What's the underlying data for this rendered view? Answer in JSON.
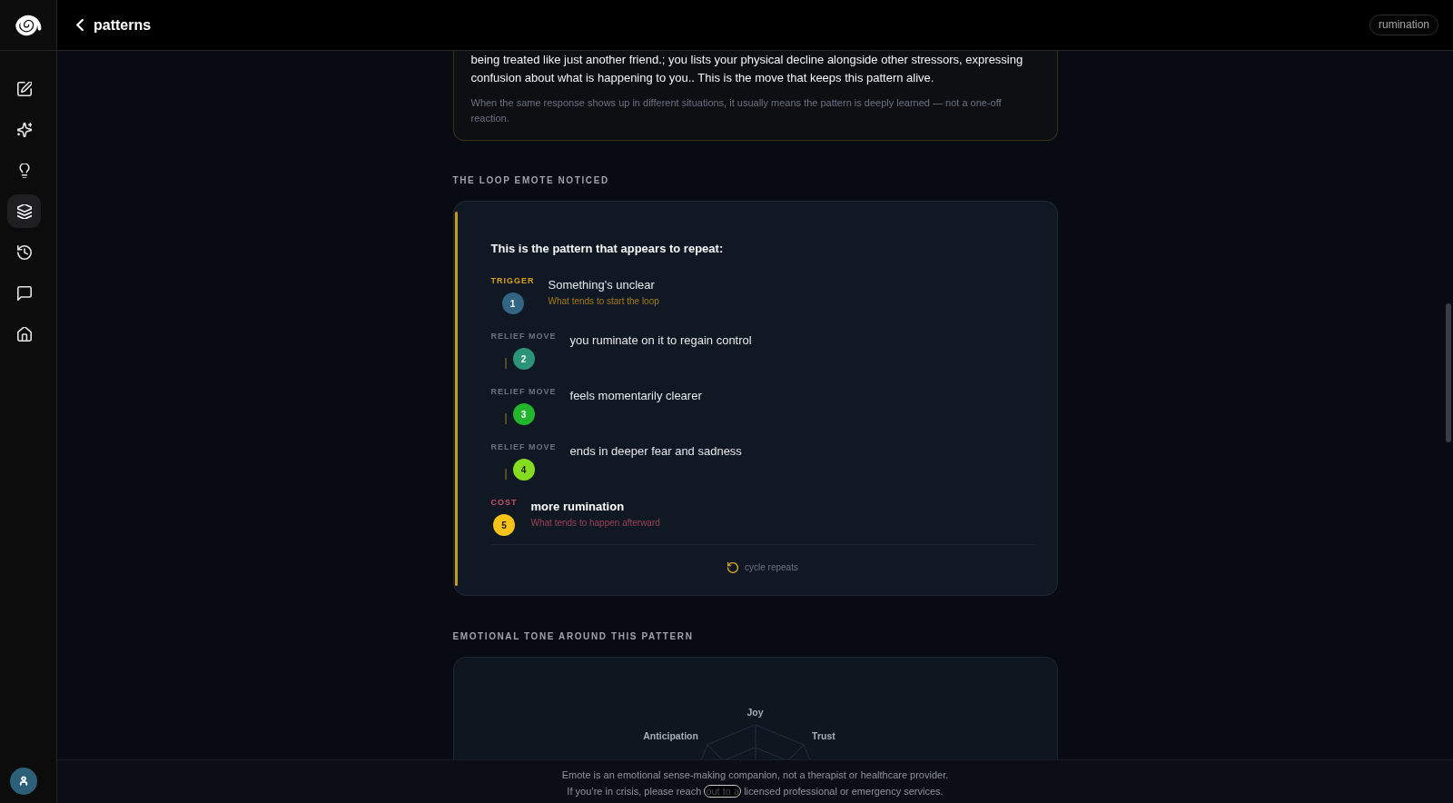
{
  "sidebar": {
    "nav_items": [
      {
        "kind": "compose",
        "selected": false
      },
      {
        "kind": "sparkle",
        "selected": false
      },
      {
        "kind": "idea",
        "selected": false
      },
      {
        "kind": "patterns",
        "selected": true
      },
      {
        "kind": "history",
        "selected": false
      },
      {
        "kind": "chat",
        "selected": false
      },
      {
        "kind": "home",
        "selected": false
      }
    ]
  },
  "header": {
    "title": "patterns",
    "tag": "rumination"
  },
  "insight_card": {
    "text": "being treated like just another friend.; you lists your physical decline alongside other stressors, expressing confusion about what is happening to you.. This is the move that keeps this pattern alive.",
    "note": "When the same response shows up in different situations, it usually means the pattern is deeply learned — not a one-off reaction."
  },
  "loop": {
    "heading": "THE LOOP EMOTE NOTICED",
    "intro": "This is the pattern that appears to repeat:",
    "steps": [
      {
        "kind": "trigger",
        "label": "TRIGGER",
        "number": "1",
        "color": "#316581",
        "text": "Something's unclear",
        "hint": "What tends to start the loop"
      },
      {
        "kind": "relief",
        "label": "RELIEF MOVE",
        "number": "2",
        "color": "#2b9479",
        "text": "you ruminate on it to regain control"
      },
      {
        "kind": "relief",
        "label": "RELIEF MOVE",
        "number": "3",
        "color": "#22b52d",
        "text": "feels momentarily clearer"
      },
      {
        "kind": "relief",
        "label": "RELIEF MOVE",
        "number": "4",
        "color": "#86dc1e",
        "text": "ends in deeper fear and sadness"
      },
      {
        "kind": "cost",
        "label": "COST",
        "number": "5",
        "color": "#f6c318",
        "text": "more rumination",
        "hint": "What tends to happen afterward"
      }
    ],
    "cycle_label": "cycle repeats"
  },
  "emotional_tone": {
    "heading": "EMOTIONAL TONE AROUND THIS PATTERN",
    "axis_labels": [
      "Joy",
      "Anticipation",
      "Trust"
    ]
  },
  "footer": {
    "disclaimer": "Emote is an emotional sense-making companion, not a therapist or healthcare provider.",
    "crisis_before": "If you’re in crisis, please reach",
    "crisis_link": "out to a",
    "crisis_after": "licensed professional or emergency services."
  }
}
